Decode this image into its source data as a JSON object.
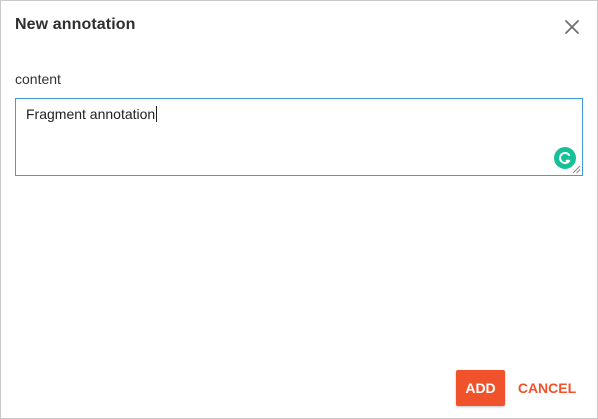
{
  "dialog": {
    "title": "New annotation",
    "close_icon": "close-icon"
  },
  "form": {
    "content_label": "content",
    "content_value": "Fragment annotation",
    "assist_icon": "grammar-assistant-icon"
  },
  "actions": {
    "add_label": "ADD",
    "cancel_label": "CANCEL"
  },
  "colors": {
    "accent": "#f0532b",
    "focus_border": "#3f9fd6",
    "assist_icon": "#16c098"
  }
}
